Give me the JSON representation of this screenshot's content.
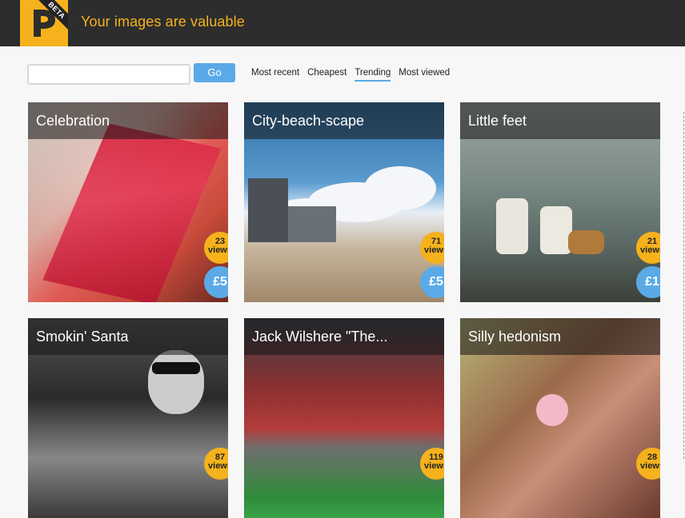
{
  "header": {
    "logo_badge": "BETA",
    "tagline": "Your images are valuable"
  },
  "search": {
    "value": "",
    "placeholder": "",
    "go_label": "Go"
  },
  "sort_tabs": [
    {
      "label": "Most recent",
      "active": false
    },
    {
      "label": "Cheapest",
      "active": false
    },
    {
      "label": "Trending",
      "active": true
    },
    {
      "label": "Most viewed",
      "active": false
    }
  ],
  "colors": {
    "accent_yellow": "#f5b21c",
    "accent_blue": "#5aaae8",
    "header_bg": "#2d2d2d"
  },
  "cards": [
    {
      "title": "Celebration",
      "views": "23",
      "views_label": "views",
      "price": "£5"
    },
    {
      "title": "City-beach-scape",
      "views": "71",
      "views_label": "views",
      "price": "£5"
    },
    {
      "title": "Little feet",
      "views": "21",
      "views_label": "views",
      "price": "£1"
    },
    {
      "title": "Smokin' Santa",
      "views": "87",
      "views_label": "views",
      "price": ""
    },
    {
      "title": "Jack Wilshere \"The...",
      "views": "119",
      "views_label": "views",
      "price": ""
    },
    {
      "title": "Silly hedonism",
      "views": "28",
      "views_label": "views",
      "price": ""
    }
  ]
}
